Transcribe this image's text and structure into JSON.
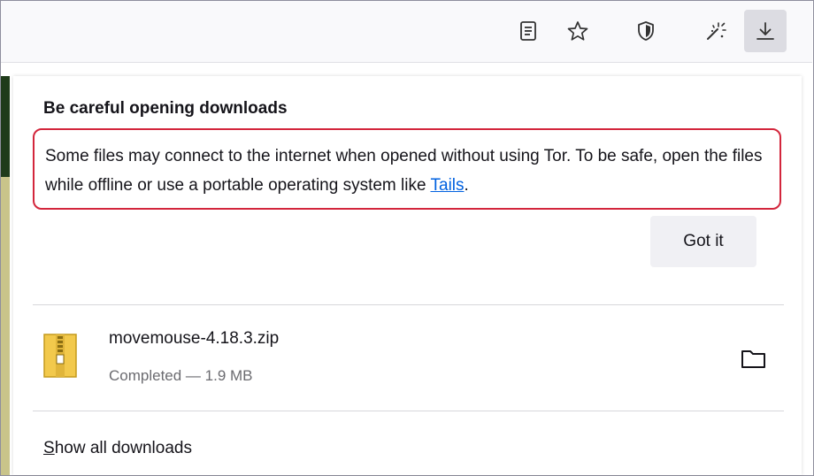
{
  "toolbar": {
    "icons": [
      "reader-view-icon",
      "bookmark-star-icon",
      "shield-icon",
      "magic-wand-icon",
      "downloads-icon"
    ]
  },
  "panel": {
    "warning_title": "Be careful opening downloads",
    "warning_text_before_link": "Some files may connect to the internet when opened without using Tor. To be safe, open the files while offline or use a portable operating system like ",
    "warning_link": "Tails",
    "warning_text_after_link": ".",
    "got_it_label": "Got it",
    "download": {
      "file_name": "movemouse-4.18.3.zip",
      "status": "Completed — 1.9 MB",
      "icon": "zip-file-icon"
    },
    "show_all_access_key": "S",
    "show_all_rest": "how all downloads"
  },
  "colors": {
    "highlight_border": "#d3263c",
    "link": "#0061e0",
    "toolbar_bg": "#f9f9fb"
  }
}
